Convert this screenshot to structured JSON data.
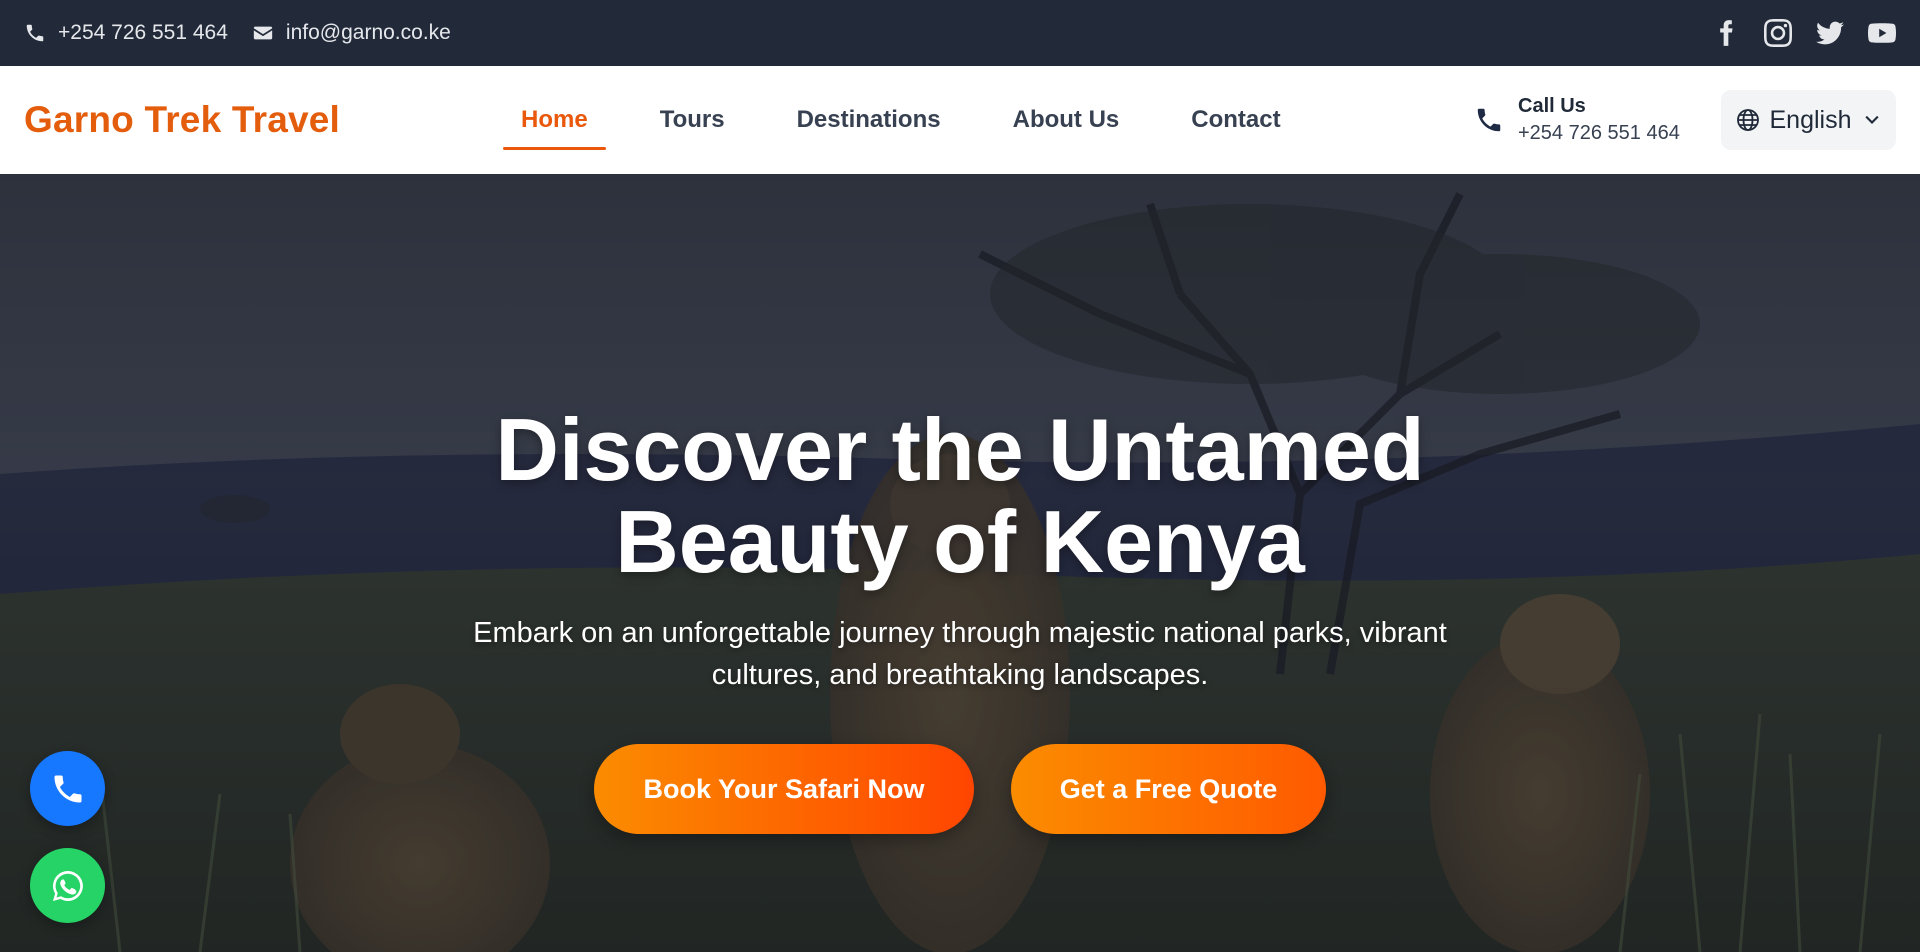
{
  "topbar": {
    "phone": "+254 726 551 464",
    "email": "info@garno.co.ke",
    "phone_icon": "phone-icon",
    "email_icon": "envelope-icon",
    "social": [
      "facebook-icon",
      "instagram-icon",
      "twitter-icon",
      "youtube-icon"
    ]
  },
  "nav": {
    "logo": "Garno Trek Travel",
    "links": [
      "Home",
      "Tours",
      "Destinations",
      "About Us",
      "Contact"
    ],
    "active": "Home",
    "call_label": "Call Us",
    "call_number": "+254 726 551 464",
    "language": "English"
  },
  "hero": {
    "title_line1": "Discover the Untamed",
    "title_line2": "Beauty of Kenya",
    "subtitle_line1": "Embark on an unforgettable journey through majestic national parks, vibrant",
    "subtitle_line2": "cultures, and breathtaking landscapes.",
    "cta_primary": "Book Your Safari Now",
    "cta_secondary": "Get a Free Quote"
  },
  "floating": {
    "phone_icon": "phone-icon",
    "whatsapp_icon": "whatsapp-icon"
  },
  "colors": {
    "brand": "#e35d0d",
    "accent": "#ea580c",
    "topbar": "#222a3a",
    "fab_phone": "#1677ff",
    "fab_whatsapp": "#25d366"
  }
}
